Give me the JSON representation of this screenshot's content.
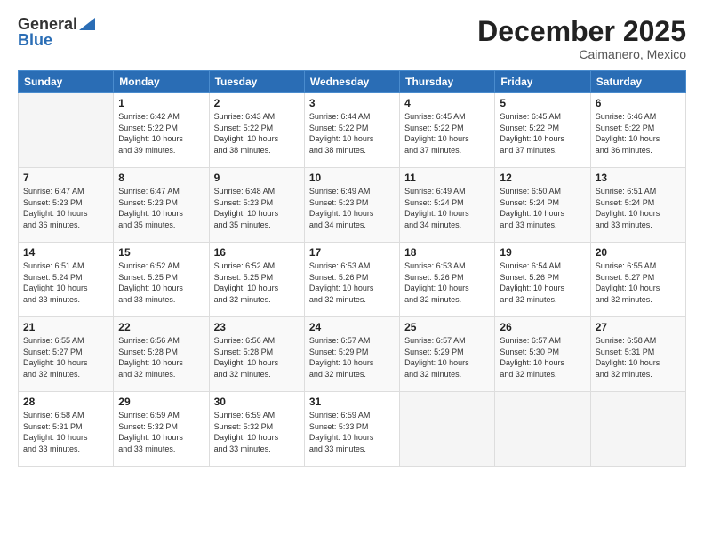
{
  "header": {
    "logo_general": "General",
    "logo_blue": "Blue",
    "month_title": "December 2025",
    "location": "Caimanero, Mexico"
  },
  "columns": [
    "Sunday",
    "Monday",
    "Tuesday",
    "Wednesday",
    "Thursday",
    "Friday",
    "Saturday"
  ],
  "weeks": [
    [
      {
        "day": "",
        "info": ""
      },
      {
        "day": "1",
        "info": "Sunrise: 6:42 AM\nSunset: 5:22 PM\nDaylight: 10 hours\nand 39 minutes."
      },
      {
        "day": "2",
        "info": "Sunrise: 6:43 AM\nSunset: 5:22 PM\nDaylight: 10 hours\nand 38 minutes."
      },
      {
        "day": "3",
        "info": "Sunrise: 6:44 AM\nSunset: 5:22 PM\nDaylight: 10 hours\nand 38 minutes."
      },
      {
        "day": "4",
        "info": "Sunrise: 6:45 AM\nSunset: 5:22 PM\nDaylight: 10 hours\nand 37 minutes."
      },
      {
        "day": "5",
        "info": "Sunrise: 6:45 AM\nSunset: 5:22 PM\nDaylight: 10 hours\nand 37 minutes."
      },
      {
        "day": "6",
        "info": "Sunrise: 6:46 AM\nSunset: 5:22 PM\nDaylight: 10 hours\nand 36 minutes."
      }
    ],
    [
      {
        "day": "7",
        "info": "Sunrise: 6:47 AM\nSunset: 5:23 PM\nDaylight: 10 hours\nand 36 minutes."
      },
      {
        "day": "8",
        "info": "Sunrise: 6:47 AM\nSunset: 5:23 PM\nDaylight: 10 hours\nand 35 minutes."
      },
      {
        "day": "9",
        "info": "Sunrise: 6:48 AM\nSunset: 5:23 PM\nDaylight: 10 hours\nand 35 minutes."
      },
      {
        "day": "10",
        "info": "Sunrise: 6:49 AM\nSunset: 5:23 PM\nDaylight: 10 hours\nand 34 minutes."
      },
      {
        "day": "11",
        "info": "Sunrise: 6:49 AM\nSunset: 5:24 PM\nDaylight: 10 hours\nand 34 minutes."
      },
      {
        "day": "12",
        "info": "Sunrise: 6:50 AM\nSunset: 5:24 PM\nDaylight: 10 hours\nand 33 minutes."
      },
      {
        "day": "13",
        "info": "Sunrise: 6:51 AM\nSunset: 5:24 PM\nDaylight: 10 hours\nand 33 minutes."
      }
    ],
    [
      {
        "day": "14",
        "info": "Sunrise: 6:51 AM\nSunset: 5:24 PM\nDaylight: 10 hours\nand 33 minutes."
      },
      {
        "day": "15",
        "info": "Sunrise: 6:52 AM\nSunset: 5:25 PM\nDaylight: 10 hours\nand 33 minutes."
      },
      {
        "day": "16",
        "info": "Sunrise: 6:52 AM\nSunset: 5:25 PM\nDaylight: 10 hours\nand 32 minutes."
      },
      {
        "day": "17",
        "info": "Sunrise: 6:53 AM\nSunset: 5:26 PM\nDaylight: 10 hours\nand 32 minutes."
      },
      {
        "day": "18",
        "info": "Sunrise: 6:53 AM\nSunset: 5:26 PM\nDaylight: 10 hours\nand 32 minutes."
      },
      {
        "day": "19",
        "info": "Sunrise: 6:54 AM\nSunset: 5:26 PM\nDaylight: 10 hours\nand 32 minutes."
      },
      {
        "day": "20",
        "info": "Sunrise: 6:55 AM\nSunset: 5:27 PM\nDaylight: 10 hours\nand 32 minutes."
      }
    ],
    [
      {
        "day": "21",
        "info": "Sunrise: 6:55 AM\nSunset: 5:27 PM\nDaylight: 10 hours\nand 32 minutes."
      },
      {
        "day": "22",
        "info": "Sunrise: 6:56 AM\nSunset: 5:28 PM\nDaylight: 10 hours\nand 32 minutes."
      },
      {
        "day": "23",
        "info": "Sunrise: 6:56 AM\nSunset: 5:28 PM\nDaylight: 10 hours\nand 32 minutes."
      },
      {
        "day": "24",
        "info": "Sunrise: 6:57 AM\nSunset: 5:29 PM\nDaylight: 10 hours\nand 32 minutes."
      },
      {
        "day": "25",
        "info": "Sunrise: 6:57 AM\nSunset: 5:29 PM\nDaylight: 10 hours\nand 32 minutes."
      },
      {
        "day": "26",
        "info": "Sunrise: 6:57 AM\nSunset: 5:30 PM\nDaylight: 10 hours\nand 32 minutes."
      },
      {
        "day": "27",
        "info": "Sunrise: 6:58 AM\nSunset: 5:31 PM\nDaylight: 10 hours\nand 32 minutes."
      }
    ],
    [
      {
        "day": "28",
        "info": "Sunrise: 6:58 AM\nSunset: 5:31 PM\nDaylight: 10 hours\nand 33 minutes."
      },
      {
        "day": "29",
        "info": "Sunrise: 6:59 AM\nSunset: 5:32 PM\nDaylight: 10 hours\nand 33 minutes."
      },
      {
        "day": "30",
        "info": "Sunrise: 6:59 AM\nSunset: 5:32 PM\nDaylight: 10 hours\nand 33 minutes."
      },
      {
        "day": "31",
        "info": "Sunrise: 6:59 AM\nSunset: 5:33 PM\nDaylight: 10 hours\nand 33 minutes."
      },
      {
        "day": "",
        "info": ""
      },
      {
        "day": "",
        "info": ""
      },
      {
        "day": "",
        "info": ""
      }
    ]
  ]
}
